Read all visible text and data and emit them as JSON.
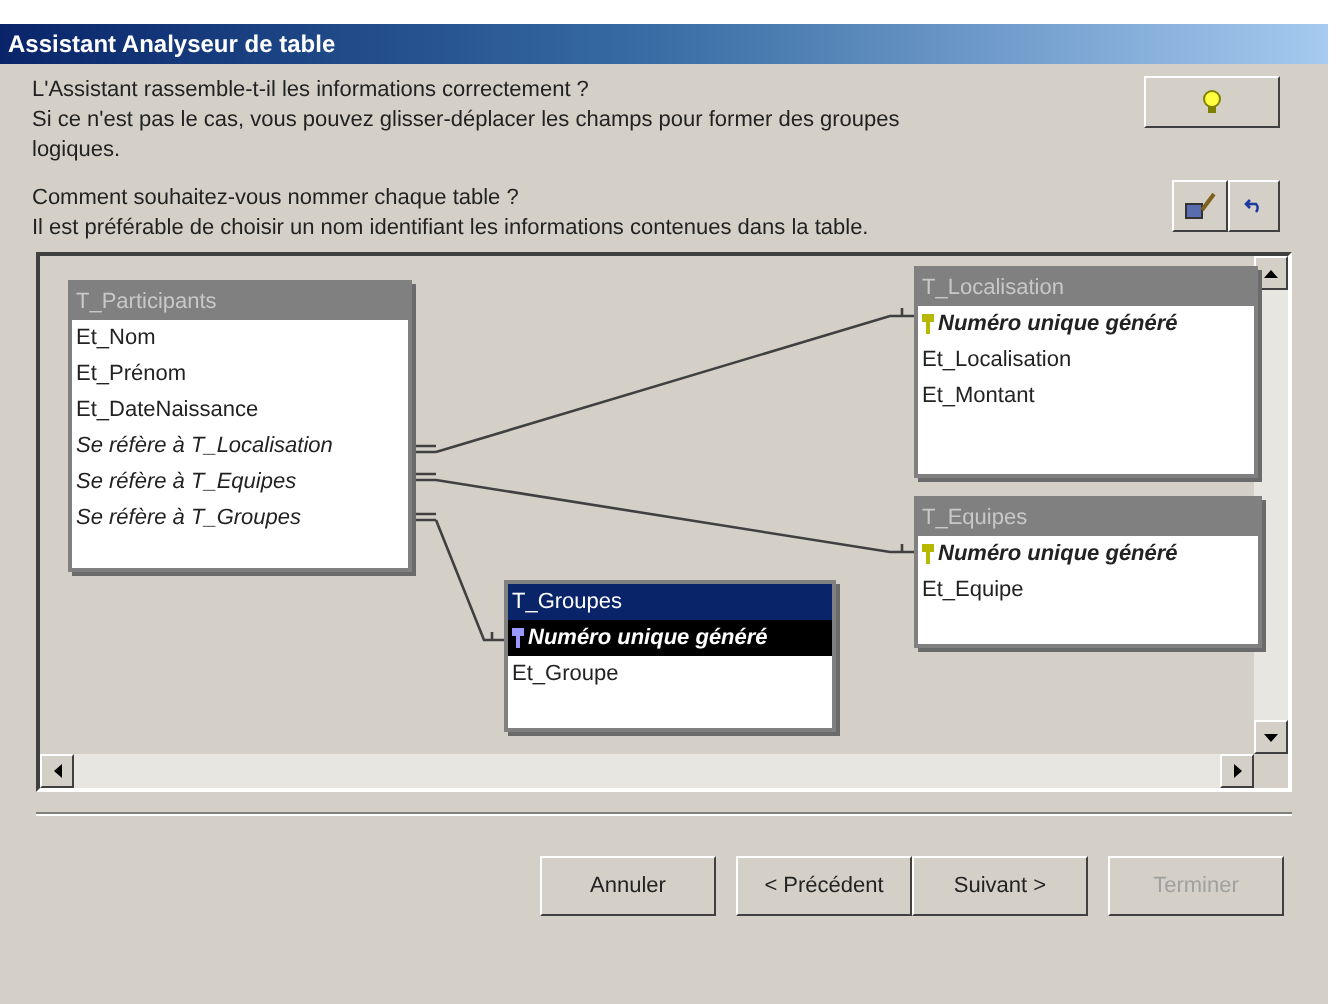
{
  "window": {
    "title": "Assistant Analyseur de table"
  },
  "instructions": [
    "L'Assistant rassemble-t-il les informations correctement ?",
    "Si ce n'est pas le cas, vous pouvez glisser-déplacer les champs pour former des groupes logiques.",
    "Comment souhaitez-vous nommer chaque table ?",
    "Il est préférable de choisir un nom identifiant les informations contenues dans la table."
  ],
  "tables": [
    {
      "name": "T_Participants",
      "selected": false,
      "fields": [
        {
          "kind": "field",
          "label": "Et_Nom",
          "selected": false
        },
        {
          "kind": "field",
          "label": "Et_Prénom",
          "selected": false
        },
        {
          "kind": "field",
          "label": "Et_DateNaissance",
          "selected": false
        },
        {
          "kind": "reference",
          "label": "Se réfère à T_Localisation",
          "selected": false
        },
        {
          "kind": "reference",
          "label": "Se réfère à T_Equipes",
          "selected": false
        },
        {
          "kind": "reference",
          "label": "Se réfère à T_Groupes",
          "selected": false
        }
      ]
    },
    {
      "name": "T_Localisation",
      "selected": false,
      "fields": [
        {
          "kind": "key",
          "label": "Numéro unique généré",
          "selected": false
        },
        {
          "kind": "field",
          "label": "Et_Localisation",
          "selected": false
        },
        {
          "kind": "field",
          "label": "Et_Montant",
          "selected": false
        }
      ]
    },
    {
      "name": "T_Equipes",
      "selected": false,
      "fields": [
        {
          "kind": "key",
          "label": "Numéro unique généré",
          "selected": false
        },
        {
          "kind": "field",
          "label": "Et_Equipe",
          "selected": false
        }
      ]
    },
    {
      "name": "T_Groupes",
      "selected": true,
      "fields": [
        {
          "kind": "key",
          "label": "Numéro unique généré",
          "selected": true
        },
        {
          "kind": "field",
          "label": "Et_Groupe",
          "selected": false
        }
      ]
    }
  ],
  "buttons": [
    {
      "label": "Annuler",
      "disabled": false
    },
    {
      "label": "< Précédent",
      "disabled": false
    },
    {
      "label": "Suivant >",
      "disabled": false
    },
    {
      "label": "Terminer",
      "disabled": true
    }
  ]
}
